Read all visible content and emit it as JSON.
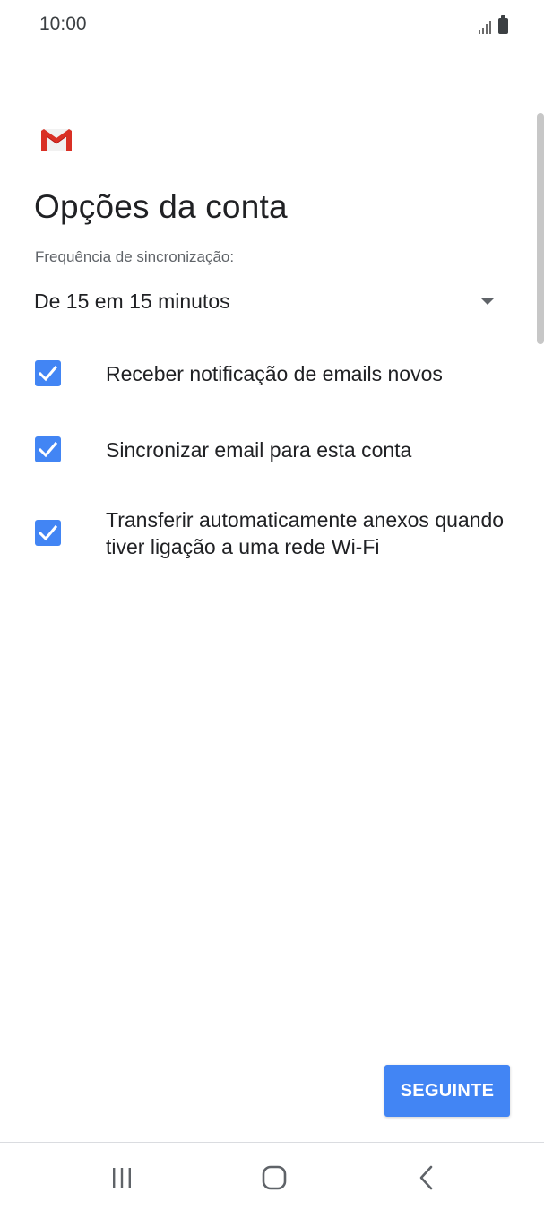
{
  "status_bar": {
    "time": "10:00",
    "icons": [
      "signal-icon",
      "battery-icon"
    ]
  },
  "app": {
    "logo": "gmail-logo",
    "colors": {
      "accent": "#4285f4",
      "gmail_red": "#d93025"
    }
  },
  "page": {
    "title": "Opções da conta"
  },
  "sync_frequency": {
    "label": "Frequência de sincronização:",
    "selected": "De 15 em 15 minutos"
  },
  "options": [
    {
      "label": "Receber notificação de emails novos",
      "checked": true
    },
    {
      "label": "Sincronizar email para esta conta",
      "checked": true
    },
    {
      "label": "Transferir automaticamente anexos quando tiver ligação a uma rede Wi-Fi",
      "checked": true
    }
  ],
  "actions": {
    "next_label": "SEGUINTE"
  },
  "nav": {
    "buttons": [
      "recents-icon",
      "home-icon",
      "back-icon"
    ]
  }
}
